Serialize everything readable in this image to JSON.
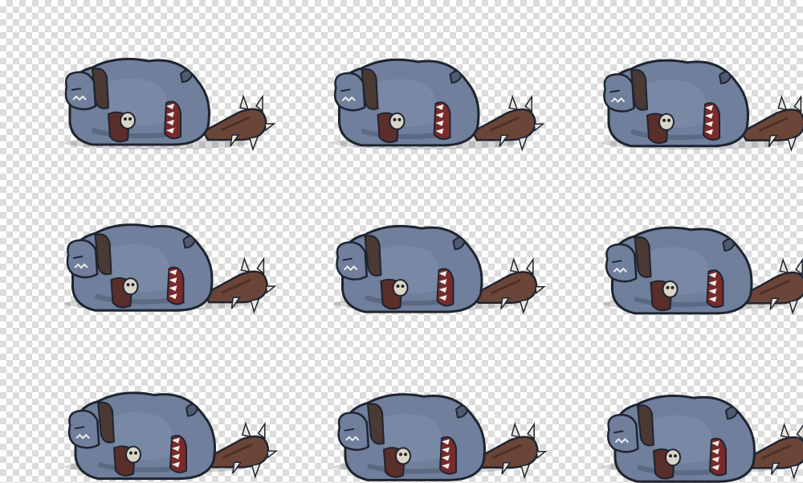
{
  "sprite_sheet": {
    "subject": "troll-ogre-death-animation",
    "grid": {
      "rows": 3,
      "cols": 3
    },
    "palette": {
      "skin": "#6f7f9c",
      "skin_shadow": "#4e5a72",
      "skin_light": "#8c9ab4",
      "outline": "#1f2430",
      "club": "#6b4638",
      "club_dark": "#4d3128",
      "collar": "#4a3a33",
      "spike": "#e8e6df",
      "skull": "#d9d6c8",
      "loincloth": "#5a2e2a",
      "mouth": "#7a2a2a",
      "teeth": "#eeeeea",
      "shadow": "rgba(40,40,40,0.18)"
    },
    "frames": [
      {
        "index": 1,
        "lean": 0
      },
      {
        "index": 2,
        "lean": 0.05
      },
      {
        "index": 3,
        "lean": 0.1
      },
      {
        "index": 4,
        "lean": 0.35
      },
      {
        "index": 5,
        "lean": 0.45
      },
      {
        "index": 6,
        "lean": 0.55
      },
      {
        "index": 7,
        "lean": 0.7
      },
      {
        "index": 8,
        "lean": 0.8
      },
      {
        "index": 9,
        "lean": 0.9
      }
    ]
  }
}
